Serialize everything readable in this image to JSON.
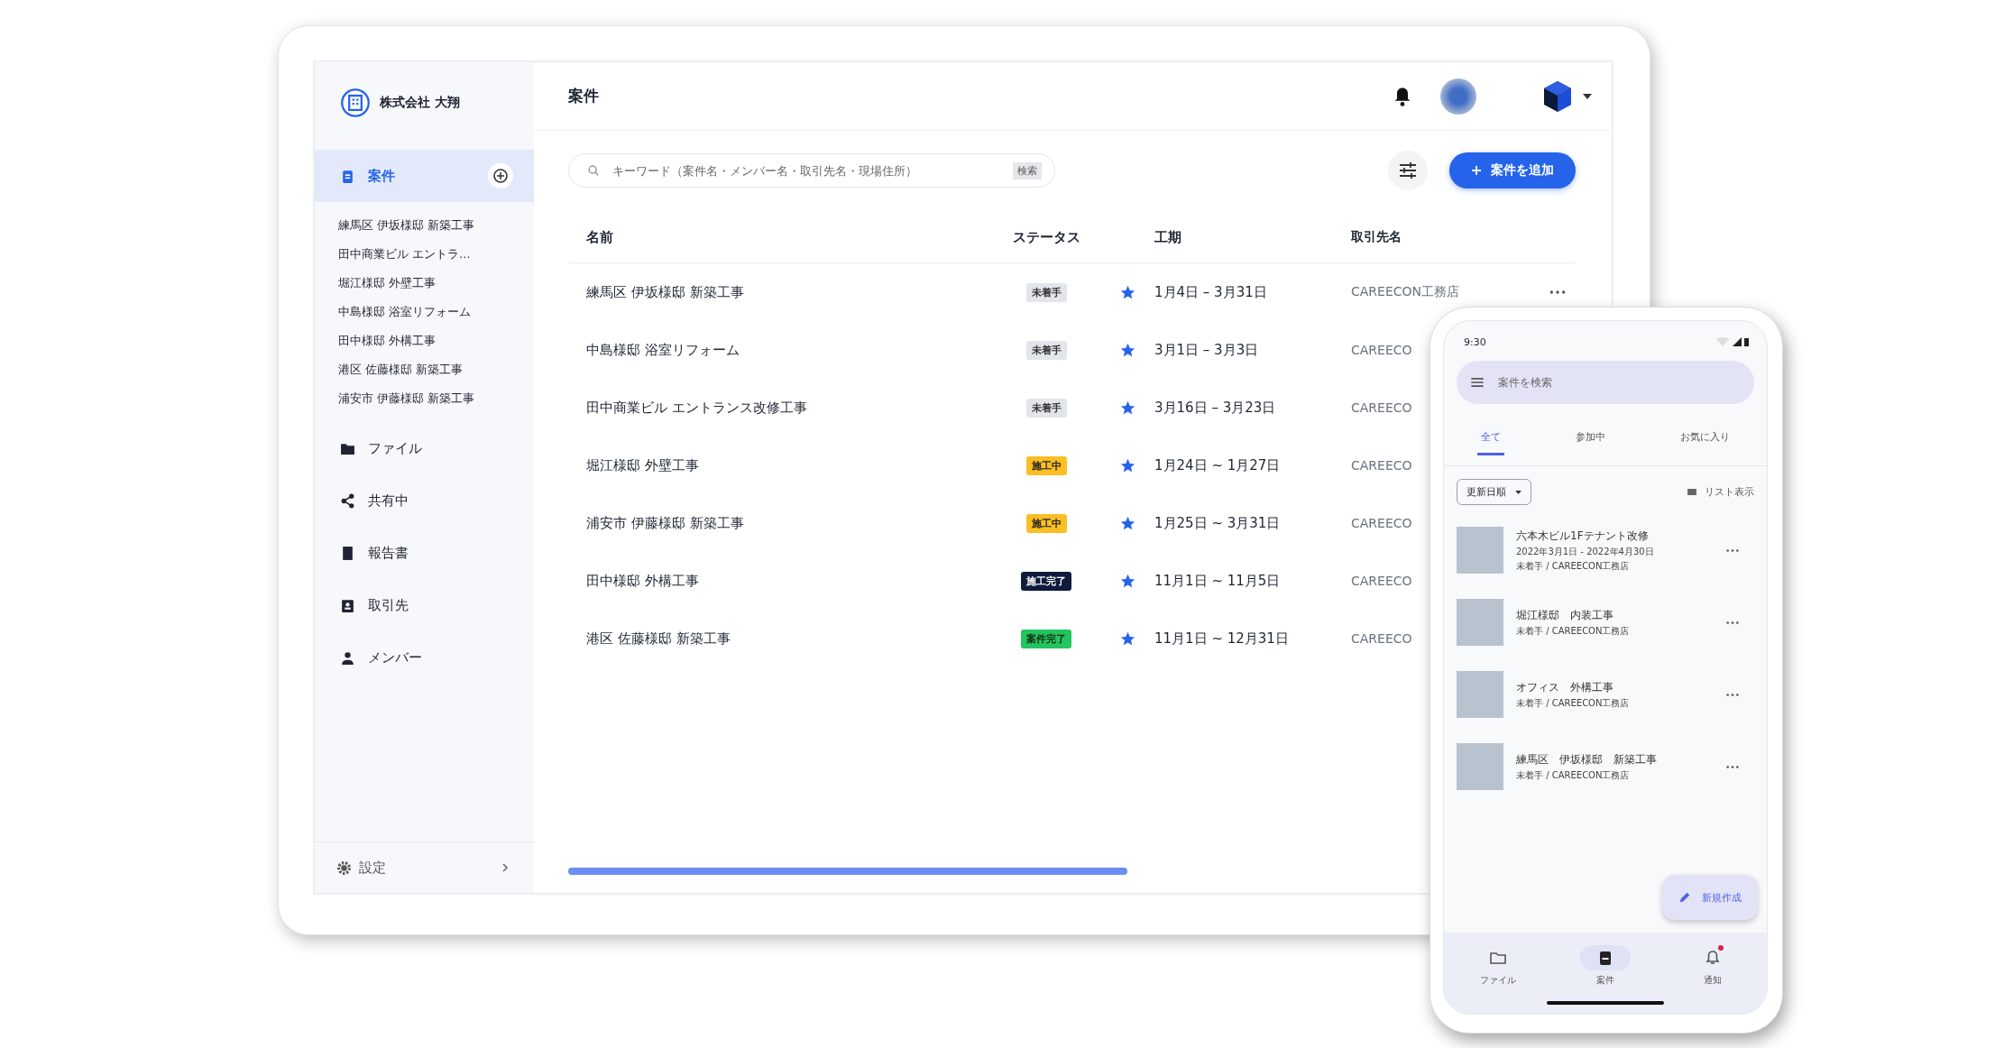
{
  "sidebar": {
    "company": "株式会社 大翔",
    "nav": [
      {
        "label": "案件",
        "kind": "projects",
        "selected": true
      },
      {
        "label": "ファイル",
        "kind": "folder",
        "selected": false
      },
      {
        "label": "共有中",
        "kind": "share",
        "selected": false
      },
      {
        "label": "報告書",
        "kind": "report",
        "selected": false
      },
      {
        "label": "取引先",
        "kind": "client",
        "selected": false
      },
      {
        "label": "メンバー",
        "kind": "member",
        "selected": false
      }
    ],
    "projects": [
      "練馬区 伊坂様邸 新築工事",
      "田中商業ビル エントラ…",
      "堀江様邸 外壁工事",
      "中島様邸 浴室リフォーム",
      "田中様邸 外構工事",
      "港区 佐藤様邸 新築工事",
      "浦安市 伊藤様邸 新築工事"
    ],
    "settings": "設定"
  },
  "header": {
    "title": "案件"
  },
  "search": {
    "placeholder": "キーワード（案件名・メンバー名・取引先名・現場住所）",
    "chip": "検索"
  },
  "add_button": "案件を追加",
  "table": {
    "columns": [
      "名前",
      "ステータス",
      "工期",
      "取引先名"
    ],
    "rows": [
      {
        "name": "練馬区 伊坂様邸 新築工事",
        "status": "未着手",
        "kind": "not_started",
        "starred": true,
        "period": "1月4日 – 3月31日",
        "client": "CAREECON工務店",
        "menu": true
      },
      {
        "name": "中島様邸 浴室リフォーム",
        "status": "未着手",
        "kind": "not_started",
        "starred": true,
        "period": "3月1日 – 3月3日",
        "client": "CAREECO",
        "menu": false
      },
      {
        "name": "田中商業ビル エントランス改修工事",
        "status": "未着手",
        "kind": "not_started",
        "starred": true,
        "period": "3月16日 – 3月23日",
        "client": "CAREECO",
        "menu": false
      },
      {
        "name": "堀江様邸 外壁工事",
        "status": "施工中",
        "kind": "in_progress",
        "starred": true,
        "period": "1月24日 ~ 1月27日",
        "client": "CAREECO",
        "menu": false
      },
      {
        "name": "浦安市 伊藤様邸 新築工事",
        "status": "施工中",
        "kind": "in_progress",
        "starred": true,
        "period": "1月25日 ~ 3月31日",
        "client": "CAREECO",
        "menu": false
      },
      {
        "name": "田中様邸 外構工事",
        "status": "施工完了",
        "kind": "built",
        "starred": true,
        "period": "11月1日 ~ 11月5日",
        "client": "CAREECO",
        "menu": false
      },
      {
        "name": "港区 佐藤様邸 新築工事",
        "status": "案件完了",
        "kind": "closed",
        "starred": true,
        "period": "11月1日 ~ 12月31日",
        "client": "CAREECO",
        "menu": false
      }
    ]
  },
  "phone": {
    "time": "9:30",
    "search_placeholder": "案件を検索",
    "tabs": [
      {
        "label": "全て",
        "selected": true
      },
      {
        "label": "参加中",
        "selected": false
      },
      {
        "label": "お気に入り",
        "selected": false
      }
    ],
    "sort": "更新日順",
    "view": "リスト表示",
    "items": [
      {
        "title": "六本木ビル1Fテナント改修",
        "date": "2022年3月1日 - 2022年4月30日",
        "meta": "未着手 / CAREECON工務店"
      },
      {
        "title": "堀江様邸　内装工事",
        "meta": "未着手 / CAREECON工務店"
      },
      {
        "title": "オフィス　外構工事",
        "meta": "未着手 / CAREECON工務店"
      },
      {
        "title": "練馬区　伊坂様邸　新築工事",
        "meta": "未着手 / CAREECON工務店"
      }
    ],
    "fab": "新規作成",
    "nav": [
      {
        "label": "ファイル",
        "kind": "folder",
        "selected": false,
        "badge": false
      },
      {
        "label": "案件",
        "kind": "projects",
        "selected": true,
        "badge": false
      },
      {
        "label": "通知",
        "kind": "bell",
        "selected": false,
        "badge": true
      }
    ]
  }
}
